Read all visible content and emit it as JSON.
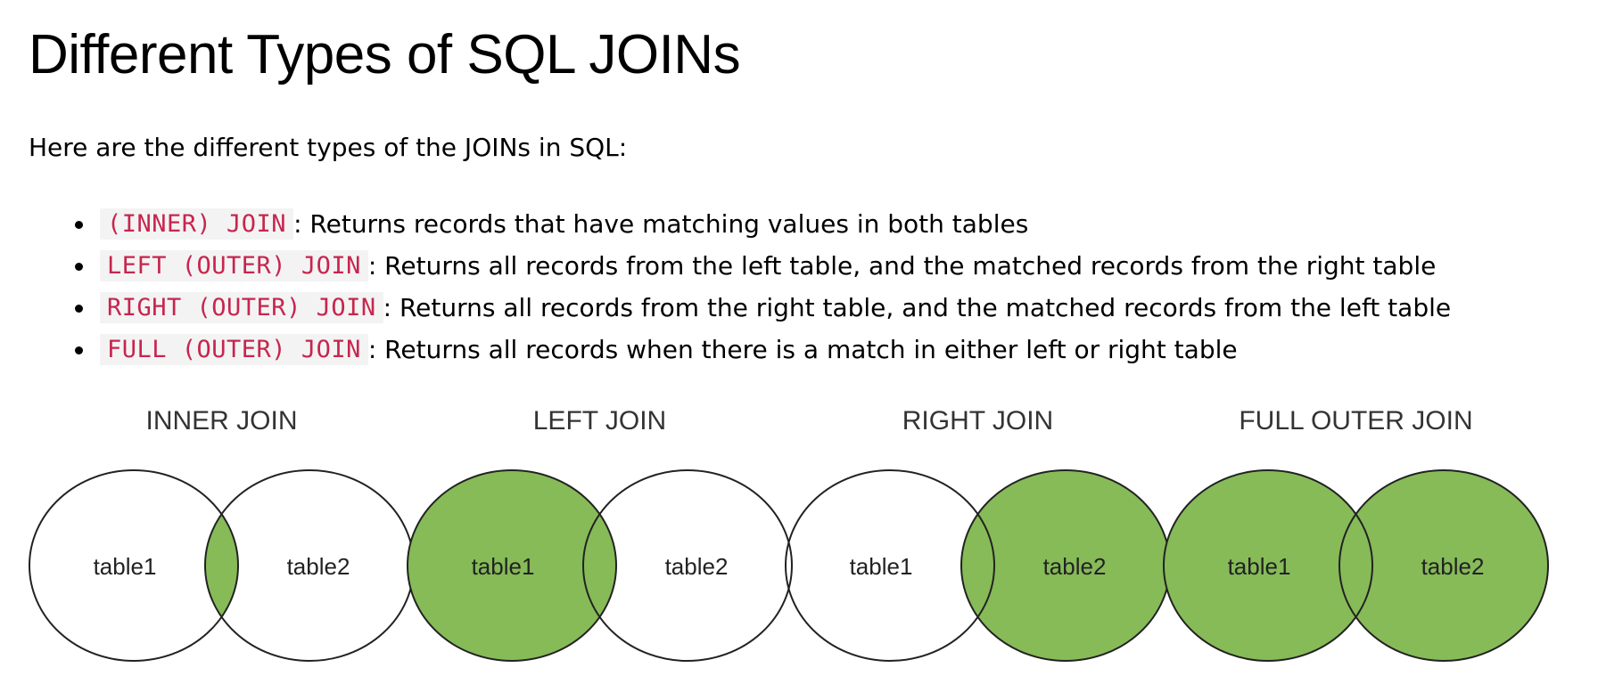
{
  "page": {
    "title": "Different Types of SQL JOINs",
    "intro": "Here are the different types of the JOINs in SQL:"
  },
  "joins": [
    {
      "code": "(INNER) JOIN",
      "description": ": Returns records that have matching values in both tables"
    },
    {
      "code": "LEFT (OUTER) JOIN",
      "description": ": Returns all records from the left table, and the matched records from the right table"
    },
    {
      "code": "RIGHT (OUTER) JOIN",
      "description": ": Returns all records from the right table, and the matched records from the left table"
    },
    {
      "code": "FULL (OUTER) JOIN",
      "description": ": Returns all records when there is a match in either left or right table"
    }
  ],
  "diagrams": [
    {
      "title": "INNER JOIN",
      "left_label": "table1",
      "right_label": "table2",
      "shaded": "intersection"
    },
    {
      "title": "LEFT JOIN",
      "left_label": "table1",
      "right_label": "table2",
      "shaded": "left"
    },
    {
      "title": "RIGHT JOIN",
      "left_label": "table1",
      "right_label": "table2",
      "shaded": "right"
    },
    {
      "title": "FULL OUTER JOIN",
      "left_label": "table1",
      "right_label": "table2",
      "shaded": "both"
    }
  ],
  "colors": {
    "fill": "#86bb58",
    "stroke": "#222222",
    "code_text": "#c7254e",
    "code_background": "#f3f3f3"
  }
}
